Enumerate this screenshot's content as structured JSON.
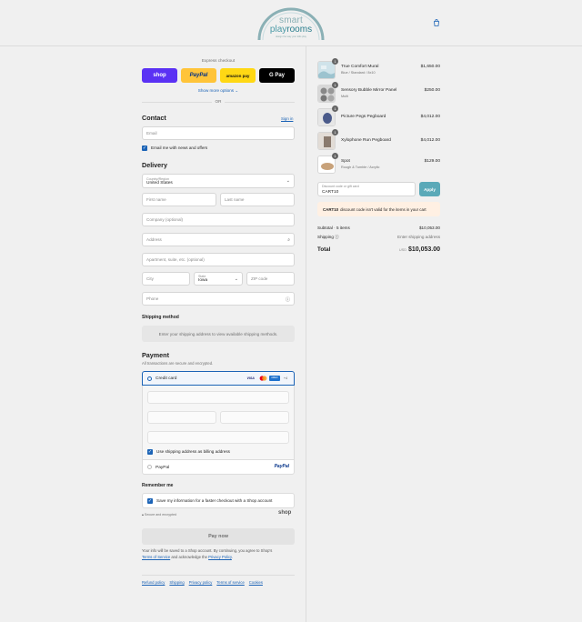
{
  "brand": {
    "line1": "smart",
    "line2a": "play",
    "line2b": "rooms",
    "tagline": "design the way your kids play",
    "colors": {
      "teal": "#4b9aa6",
      "accent": "#1b63b6"
    }
  },
  "cart_icon": "shopping-bag-icon",
  "express": {
    "label": "Express checkout",
    "buttons": [
      "shop",
      "PayPal",
      "amazon pay",
      "G Pay"
    ],
    "more": "Show more options",
    "or": "OR"
  },
  "contact": {
    "title": "Contact",
    "signin": "Sign in",
    "email_placeholder": "Email",
    "news_label": "Email me with news and offers"
  },
  "delivery": {
    "title": "Delivery",
    "country_label": "Country/Region",
    "country_value": "United States",
    "first_name": "First name",
    "last_name": "Last name",
    "company": "Company (optional)",
    "address": "Address",
    "apartment": "Apartment, suite, etc. (optional)",
    "city": "City",
    "state_label": "State",
    "state_value": "Iowa",
    "zip": "ZIP code",
    "phone": "Phone"
  },
  "shipping_method": {
    "title": "Shipping method",
    "message": "Enter your shipping address to view available shipping methods."
  },
  "payment": {
    "title": "Payment",
    "subtitle": "All transactions are secure and encrypted.",
    "credit_card": "Credit card",
    "card_logos": [
      "VISA",
      "mastercard",
      "AMEX",
      "+4"
    ],
    "billing_same": "Use shipping address as billing address",
    "paypal": "PayPal"
  },
  "remember": {
    "title": "Remember me",
    "save_label": "Save my information for a faster checkout with a Shop account",
    "secure": "Secure and encrypted",
    "shop_logo": "shop"
  },
  "pay_now": "Pay now",
  "legal": {
    "line1": "Your info will be saved to a Shop account. By continuing, you agree to Shop's",
    "tos": "Terms of Service",
    "and": " and acknowledge the ",
    "privacy": "Privacy Policy",
    "end": "."
  },
  "footer_links": [
    "Refund policy",
    "Shipping",
    "Privacy policy",
    "Terms of service",
    "Cookies"
  ],
  "order_items": [
    {
      "name": "True Comfort Mural",
      "variant": "Blue / Standard / 8x10",
      "price": "$1,650.00",
      "qty": "1"
    },
    {
      "name": "Sensory Bubble Mirror Panel",
      "variant": "Multi",
      "price": "$250.00",
      "qty": "1"
    },
    {
      "name": "Picture Pegs Pegboard",
      "variant": "",
      "price": "$4,012.00",
      "qty": "1"
    },
    {
      "name": "Xylophone Run Pegboard",
      "variant": "",
      "price": "$4,012.00",
      "qty": "1"
    },
    {
      "name": "Spot",
      "variant": "Rough & Tumble / Acrylic",
      "price": "$129.00",
      "qty": "1"
    }
  ],
  "discount": {
    "label": "Discount code or gift card",
    "value": "CART10",
    "apply": "Apply",
    "warning_code": "CART10",
    "warning_text": "discount code isn't valid for the items in your cart"
  },
  "summary": {
    "subtotal_label": "Subtotal · 5 items",
    "subtotal_value": "$10,053.00",
    "shipping_label": "Shipping",
    "shipping_value": "Enter shipping address",
    "total_label": "Total",
    "currency": "USD",
    "total_value": "$10,053.00"
  }
}
